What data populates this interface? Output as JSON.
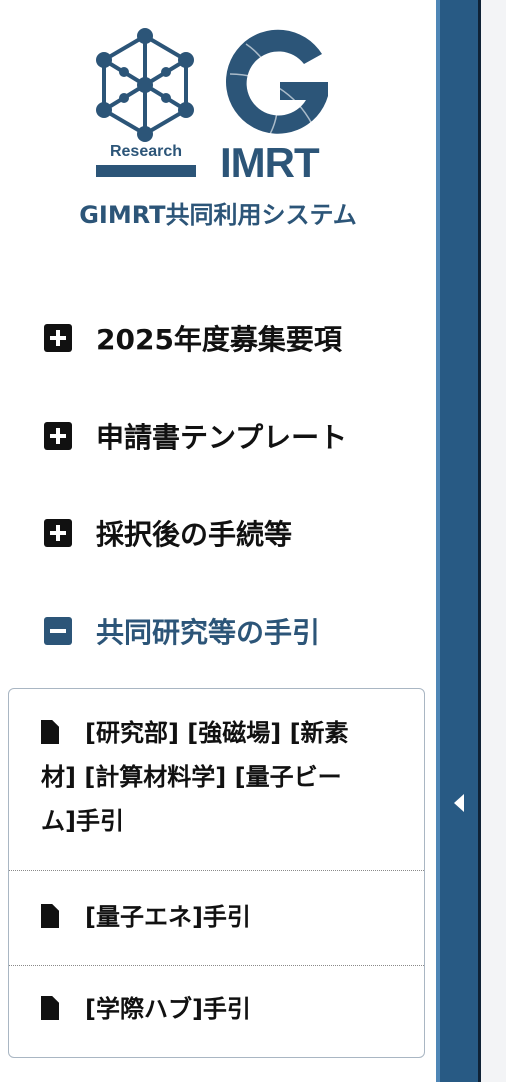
{
  "logo": {
    "research_label": "Research",
    "imrt_label": "IMRT",
    "brand_color": "#2c5578"
  },
  "system_title": "GIMRT共同利用システム",
  "menu": {
    "items": [
      {
        "label": "2025年度募集要項",
        "icon": "plus-square-icon",
        "expanded": false
      },
      {
        "label": "申請書テンプレート",
        "icon": "plus-square-icon",
        "expanded": false
      },
      {
        "label": "採択後の手続等",
        "icon": "plus-square-icon",
        "expanded": false
      },
      {
        "label": "共同研究等の手引",
        "icon": "minus-square-icon",
        "expanded": true
      }
    ],
    "subitems": [
      {
        "line1": "[研究部] [強磁場] [新素",
        "line2": "材] [計算材料学] [量子ビー",
        "line3": "ム]手引",
        "icon": "file-icon"
      },
      {
        "label": "[量子エネ]手引",
        "icon": "file-icon"
      },
      {
        "label": "[学際ハブ]手引",
        "icon": "file-icon"
      }
    ]
  },
  "colors": {
    "accent": "#2c5578",
    "collapse_strip": "#285a84",
    "sidebar_edge": "#4e86b6"
  }
}
